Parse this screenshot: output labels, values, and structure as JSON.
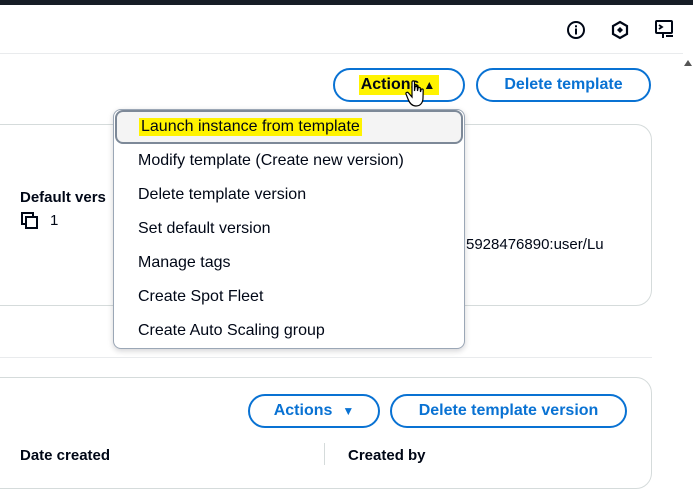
{
  "utility_bar": {
    "icons": [
      "info-icon",
      "settings-hex-icon",
      "cloudshell-icon"
    ]
  },
  "header_actions": {
    "actions_label": "Actions",
    "delete_template_label": "Delete template"
  },
  "actions_menu": {
    "items": [
      "Launch instance from template",
      "Modify template (Create new version)",
      "Delete template version",
      "Set default version",
      "Manage tags",
      "Create Spot Fleet",
      "Create Auto Scaling group"
    ]
  },
  "details": {
    "default_version_label": "Default vers",
    "default_version_value": "1",
    "owner_value": "5928476890:user/Lu"
  },
  "version_panel": {
    "actions_label": "Actions",
    "delete_version_label": "Delete template version",
    "col_date_created": "Date created",
    "col_created_by": "Created by"
  },
  "colors": {
    "primary": "#0972d3",
    "highlight": "#fff300",
    "text": "#000716"
  }
}
